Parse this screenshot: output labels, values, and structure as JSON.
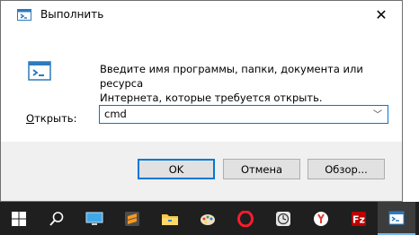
{
  "window": {
    "title": "Выполнить",
    "close_glyph": "✕"
  },
  "content": {
    "description_line1": "Введите имя программы, папки, документа или ресурса",
    "description_line2": "Интернета, которые требуется открыть.",
    "open_label_accel": "О",
    "open_label_rest": "ткрыть:",
    "input_value": "cmd",
    "dropdown_glyph": "﹀"
  },
  "buttons": {
    "ok": "OK",
    "cancel": "Отмена",
    "browse": "Обзор..."
  },
  "taskbar": {
    "items": [
      "windows-start-icon",
      "search-icon",
      "this-pc-icon",
      "sublime-text-icon",
      "file-explorer-icon",
      "paint-icon",
      "opera-icon",
      "clock-app-icon",
      "yandex-browser-icon",
      "filezilla-icon",
      "run-dialog-icon"
    ]
  },
  "colors": {
    "accent": "#0078d7",
    "taskbar": "#1f1f1f"
  }
}
